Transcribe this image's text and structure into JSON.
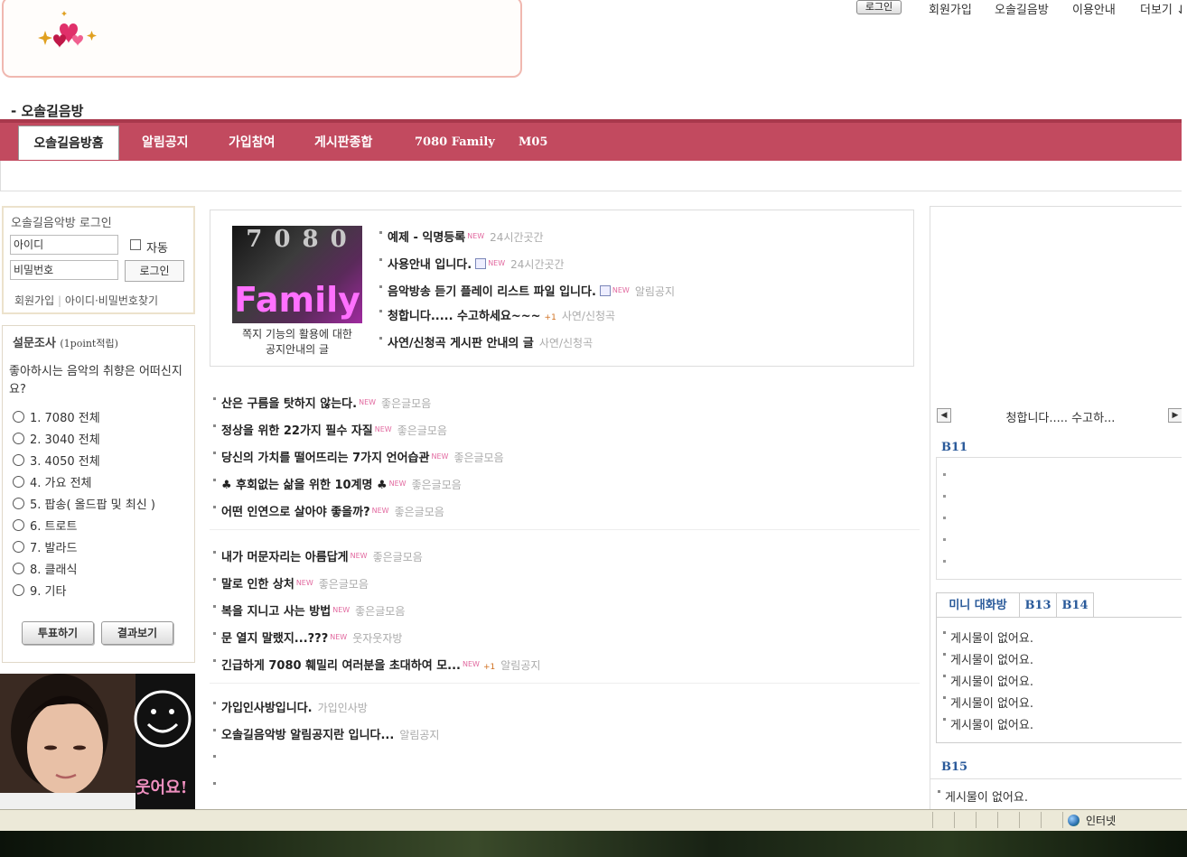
{
  "header": {
    "login_button": "로그인",
    "links": [
      "회원가입",
      "오솔길음방",
      "이용안내",
      "더보기 ↓"
    ],
    "cafe_title": "- 오솔길음방"
  },
  "nav": {
    "tabs": [
      "오솔길음방홈",
      "알림공지",
      "가입참여",
      "게시판종합",
      "7080 Family",
      "M05"
    ]
  },
  "login": {
    "title": "오솔길음악방 로그인",
    "id_placeholder": "아이디",
    "pw_placeholder": "비밀번호",
    "auto_label": "자동",
    "login_button": "로그인",
    "join_link": "회원가입",
    "separator": "|",
    "find_link": "아이디·비밀번호찾기"
  },
  "poll": {
    "title": "설문조사",
    "title_note": "(1point적립)",
    "question": "좋아하시는 음악의 취향은 어떠신지요?",
    "options": [
      "1. 7080 전체",
      "2. 3040 전체",
      "3. 4050 전체",
      "4. 가요 전체",
      "5. 팝송( 올드팝 및 최신 )",
      "6. 트로트",
      "7. 발라드",
      "8. 클래식",
      "9. 기타"
    ],
    "vote_button": "투표하기",
    "result_button": "결과보기"
  },
  "photo": {
    "caption": "웃어요!"
  },
  "feature": {
    "image_text_top": "7 0 8 0",
    "image_text_main": "Family",
    "caption": "쪽지 기능의 활용에 대한 공지안내의 글",
    "items": [
      {
        "title": "예제 - 익명등록",
        "new": "NEW",
        "category": "24시간곳간"
      },
      {
        "title": "사용안내 입니다.",
        "new": "NEW",
        "category": "24시간곳간"
      },
      {
        "title": "음악방송 듣기 플레이 리스트 파일 입니다.",
        "new": "NEW",
        "category": "알림공지"
      },
      {
        "title": "청합니다..... 수고하세요~~~",
        "plus": "+1",
        "category": "사연/신청곡"
      },
      {
        "title": "사연/신청곡 게시판 안내의 글",
        "category": "사연/신청곡"
      }
    ]
  },
  "list1": [
    {
      "title": "산은 구름을 탓하지 않는다.",
      "new": "NEW",
      "category": "좋은글모음"
    },
    {
      "title": "정상을 위한 22가지 필수 자질",
      "new": "NEW",
      "category": "좋은글모음"
    },
    {
      "title": "당신의 가치를 떨어뜨리는 7가지 언어습관",
      "new": "NEW",
      "category": "좋은글모음"
    },
    {
      "title": "♣ 후회없는 삶을 위한 10계명 ♣",
      "new": "NEW",
      "category": "좋은글모음"
    },
    {
      "title": "어떤 인연으로 살아야 좋을까?",
      "new": "NEW",
      "category": "좋은글모음"
    }
  ],
  "list2": [
    {
      "title": "내가 머문자리는 아름답게",
      "new": "NEW",
      "category": "좋은글모음"
    },
    {
      "title": "말로 인한 상처",
      "new": "NEW",
      "category": "좋은글모음"
    },
    {
      "title": "복을 지니고 사는 방법",
      "new": "NEW",
      "category": "좋은글모음"
    },
    {
      "title": "문 열지 말랬지...???",
      "new": "NEW",
      "category": "웃자웃자방"
    },
    {
      "title": "긴급하게 7080 훼밀리 여러분을 초대하여 모...",
      "new": "NEW",
      "plus": "+1",
      "category": "알림공지"
    }
  ],
  "list3": [
    {
      "title": "가입인사방입니다.",
      "category": "가입인사방"
    },
    {
      "title": "오솔길음악방 알림공지란 입니다...",
      "category": "알림공지"
    }
  ],
  "right": {
    "ticker_text": "청합니다..... 수고하...",
    "b11_title": "B11",
    "tabs": [
      "미니 대화방",
      "B13",
      "B14"
    ],
    "mini_items": [
      "게시물이 없어요.",
      "게시물이 없어요.",
      "게시물이 없어요.",
      "게시물이 없어요.",
      "게시물이 없어요."
    ],
    "b15_title": "B15",
    "b15_item": "게시물이 없어요."
  },
  "statusbar": {
    "zone": "인터넷"
  },
  "colors": {
    "nav_bg": "#c24a5f",
    "link_blue": "#2a5a9a",
    "new_pink": "#e26aa0"
  }
}
